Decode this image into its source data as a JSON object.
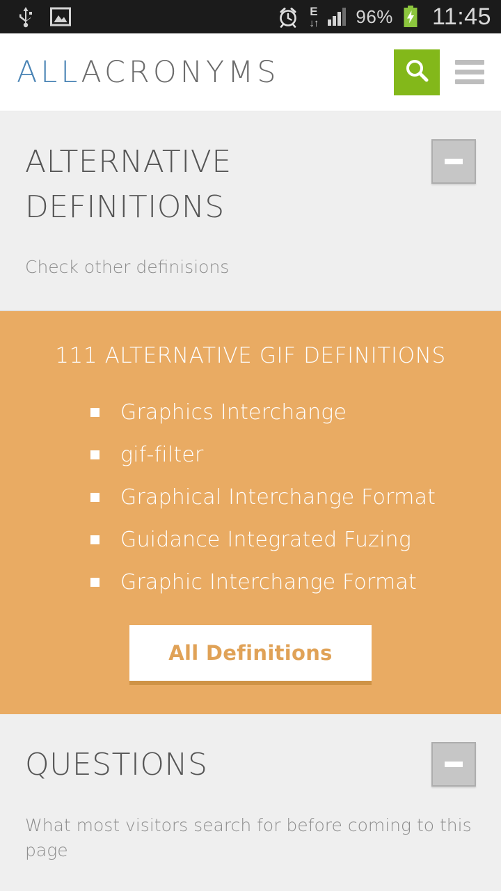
{
  "statusbar": {
    "icons": [
      "usb-icon",
      "gallery-icon",
      "alarm-icon",
      "edge-network-icon",
      "signal-icon",
      "battery-charging-icon"
    ],
    "network_type": "E",
    "network_arrows": "↓↑",
    "battery_percent": "96%",
    "clock": "11:45",
    "background_color": "#1b1b1b"
  },
  "header": {
    "logo_part_1": "ALL",
    "logo_part_2": "ACRONYMS",
    "logo_color_1": "#4a84b5",
    "logo_color_2": "#6b6b6b",
    "search_label": "search-icon",
    "search_bg": "#83b81a",
    "menu_label": "menu-icon"
  },
  "alternative_section": {
    "title": "ALTERNATIVE DEFINITIONS",
    "subtitle": "Check other definisions",
    "collapse_label": "−"
  },
  "definitions_panel": {
    "heading": "111 ALTERNATIVE GIF DEFINITIONS",
    "background_color": "#e9ab63",
    "items": [
      "Graphics Interchange",
      "gif-filter",
      "Graphical Interchange Format",
      "Guidance Integrated Fuzing",
      "Graphic Interchange Format"
    ],
    "button_label": "All Definitions",
    "button_text_color": "#e0a257"
  },
  "questions_section": {
    "title": "QUESTIONS",
    "subtitle": "What most visitors search for before coming to this page",
    "collapse_label": "−"
  }
}
